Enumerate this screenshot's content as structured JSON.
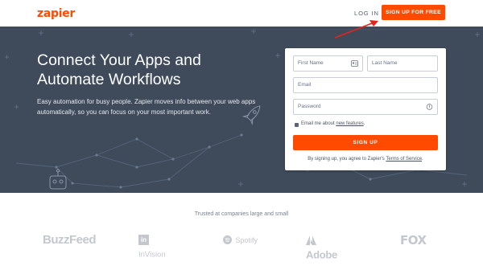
{
  "header": {
    "logo": "zapier",
    "login_label": "LOG IN",
    "signup_label": "SIGN UP FOR FREE"
  },
  "hero": {
    "headline": "Connect Your Apps and Automate Workflows",
    "subtext": "Easy automation for busy people. Zapier moves info between your web apps automatically, so you can focus on your most important work."
  },
  "form": {
    "first_name_placeholder": "First Name",
    "last_name_placeholder": "Last Name",
    "email_placeholder": "Email",
    "password_placeholder": "Password",
    "checkbox_checked": true,
    "checkbox_label_prefix": "Email me about ",
    "checkbox_label_link": "new features",
    "checkbox_label_suffix": ".",
    "submit_label": "SIGN UP",
    "terms_prefix": "By signing up, you agree to Zapier's ",
    "terms_link": "Terms of Service",
    "terms_suffix": "."
  },
  "trusted": {
    "heading": "Trusted at companies large and small",
    "logos": [
      "BuzzFeed",
      "InVision",
      "Spotify",
      "Adobe",
      "FOX"
    ]
  },
  "colors": {
    "brand": "#ff4a00",
    "hero_bg": "#3f4b5b",
    "annotation_arrow": "#e8231b",
    "logo_gray": "#c4c7cd"
  }
}
